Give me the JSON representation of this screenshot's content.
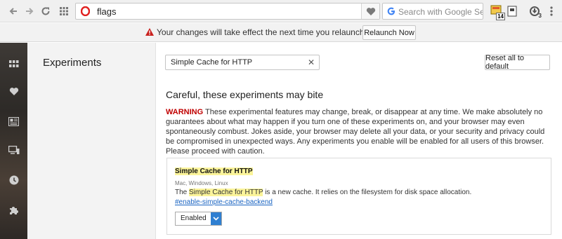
{
  "toolbar": {
    "url": "flags",
    "search_placeholder": "Search with Google Se",
    "ext_badge_a": "14",
    "ext_badge_b": "3"
  },
  "infobar": {
    "message": "Your changes will take effect the next time you relaunch Opera.",
    "button": "Relaunch Now"
  },
  "nav": {
    "title": "Experiments"
  },
  "main": {
    "filter_value": "Simple Cache for HTTP",
    "reset_button": "Reset all to default",
    "heading": "Careful, these experiments may bite",
    "warning_label": "WARNING",
    "warning_text": "These experimental features may change, break, or disappear at any time. We make absolutely no guarantees about what may happen if you turn one of these experiments on, and your browser may even spontaneously combust. Jokes aside, your browser may delete all your data, or your security and privacy could be compromised in unexpected ways. Any experiments you enable will be enabled for all users of this browser. Please proceed with caution."
  },
  "experiment": {
    "title": "Simple Cache for HTTP",
    "platforms": "Mac, Windows, Linux",
    "desc_prefix": "The",
    "desc_highlight": "Simple Cache for HTTP",
    "desc_suffix": "is a new cache. It relies on the filesystem for disk space allocation.",
    "link": "#enable-simple-cache-backend",
    "select_value": "Enabled"
  },
  "colors": {
    "accent": "#2f7fd1",
    "warning": "#c00000",
    "highlight": "#fbf49a"
  },
  "icons": [
    "back-icon",
    "forward-icon",
    "reload-icon",
    "speed-dial-icon",
    "opera-logo-icon",
    "heart-icon",
    "google-icon",
    "extension-icon",
    "extension-icon",
    "update-icon",
    "menu-icon",
    "warning-icon",
    "apps-icon",
    "news-icon",
    "devices-icon",
    "history-icon",
    "puzzle-icon",
    "chevron-down-icon"
  ]
}
